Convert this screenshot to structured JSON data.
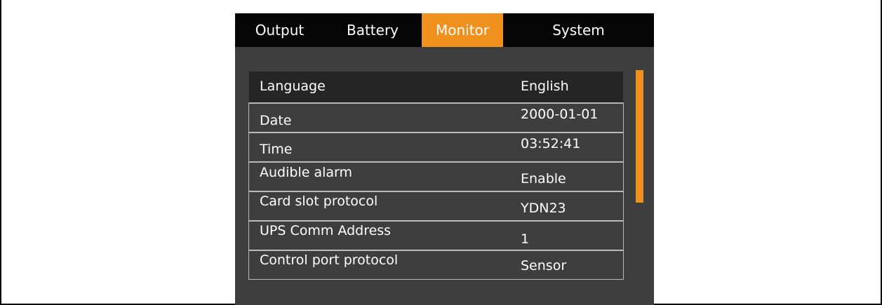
{
  "tabs": [
    {
      "label": "Output"
    },
    {
      "label": "Battery"
    },
    {
      "label": "Monitor",
      "active": true
    },
    {
      "label": "System"
    }
  ],
  "settings": [
    {
      "label": "Language",
      "value": "English"
    },
    {
      "label": "Date",
      "value": "2000-01-01"
    },
    {
      "label": "Time",
      "value": "03:52:41"
    },
    {
      "label": "Audible alarm",
      "value": "Enable"
    },
    {
      "label": "Card slot protocol",
      "value": "YDN23"
    },
    {
      "label": "UPS Comm Address",
      "value": "1"
    },
    {
      "label": "Control port protocol",
      "value": "Sensor"
    }
  ],
  "colors": {
    "accent": "#f0911e",
    "panel_background": "#3e3e3e",
    "tabbar_background": "#050505",
    "selected_row_background": "#252525",
    "row_border": "#b9b9b9"
  }
}
